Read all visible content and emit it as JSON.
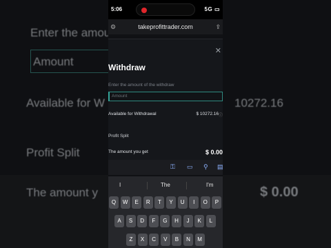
{
  "background_zoom": {
    "left": {
      "enter_amount": "Enter the amou",
      "amount_placeholder": "Amount",
      "available": "Available for W",
      "profit_split": "Profit Split",
      "amount_you": "The amount y"
    },
    "right": {
      "balance": "10272.16",
      "amount_value": "$ 0.00"
    }
  },
  "status_bar": {
    "time": "5:06",
    "network": "5G"
  },
  "browser": {
    "url": "takeprofittrader.com"
  },
  "withdraw_modal": {
    "title": "Withdraw",
    "instruction": "Enter the amount of the withdraw",
    "amount_placeholder": "Amount",
    "available_label": "Available for Withdrawal",
    "available_value": "$ 10272.16",
    "profit_split_label": "Profit Split",
    "amount_you_get_label": "The amount you get",
    "amount_you_get_value": "$ 0.00"
  },
  "keyboard": {
    "suggestions": [
      "I",
      "The",
      "I'm"
    ],
    "row1": [
      "Q",
      "W",
      "E",
      "R",
      "T",
      "Y",
      "U",
      "I",
      "O",
      "P"
    ],
    "row2": [
      "A",
      "S",
      "D",
      "F",
      "G",
      "H",
      "J",
      "K",
      "L"
    ],
    "row3": [
      "Z",
      "X",
      "C",
      "V",
      "B",
      "N",
      "M"
    ]
  },
  "colors": {
    "accent_teal": "#34a69a",
    "record_red": "#e0262b"
  }
}
